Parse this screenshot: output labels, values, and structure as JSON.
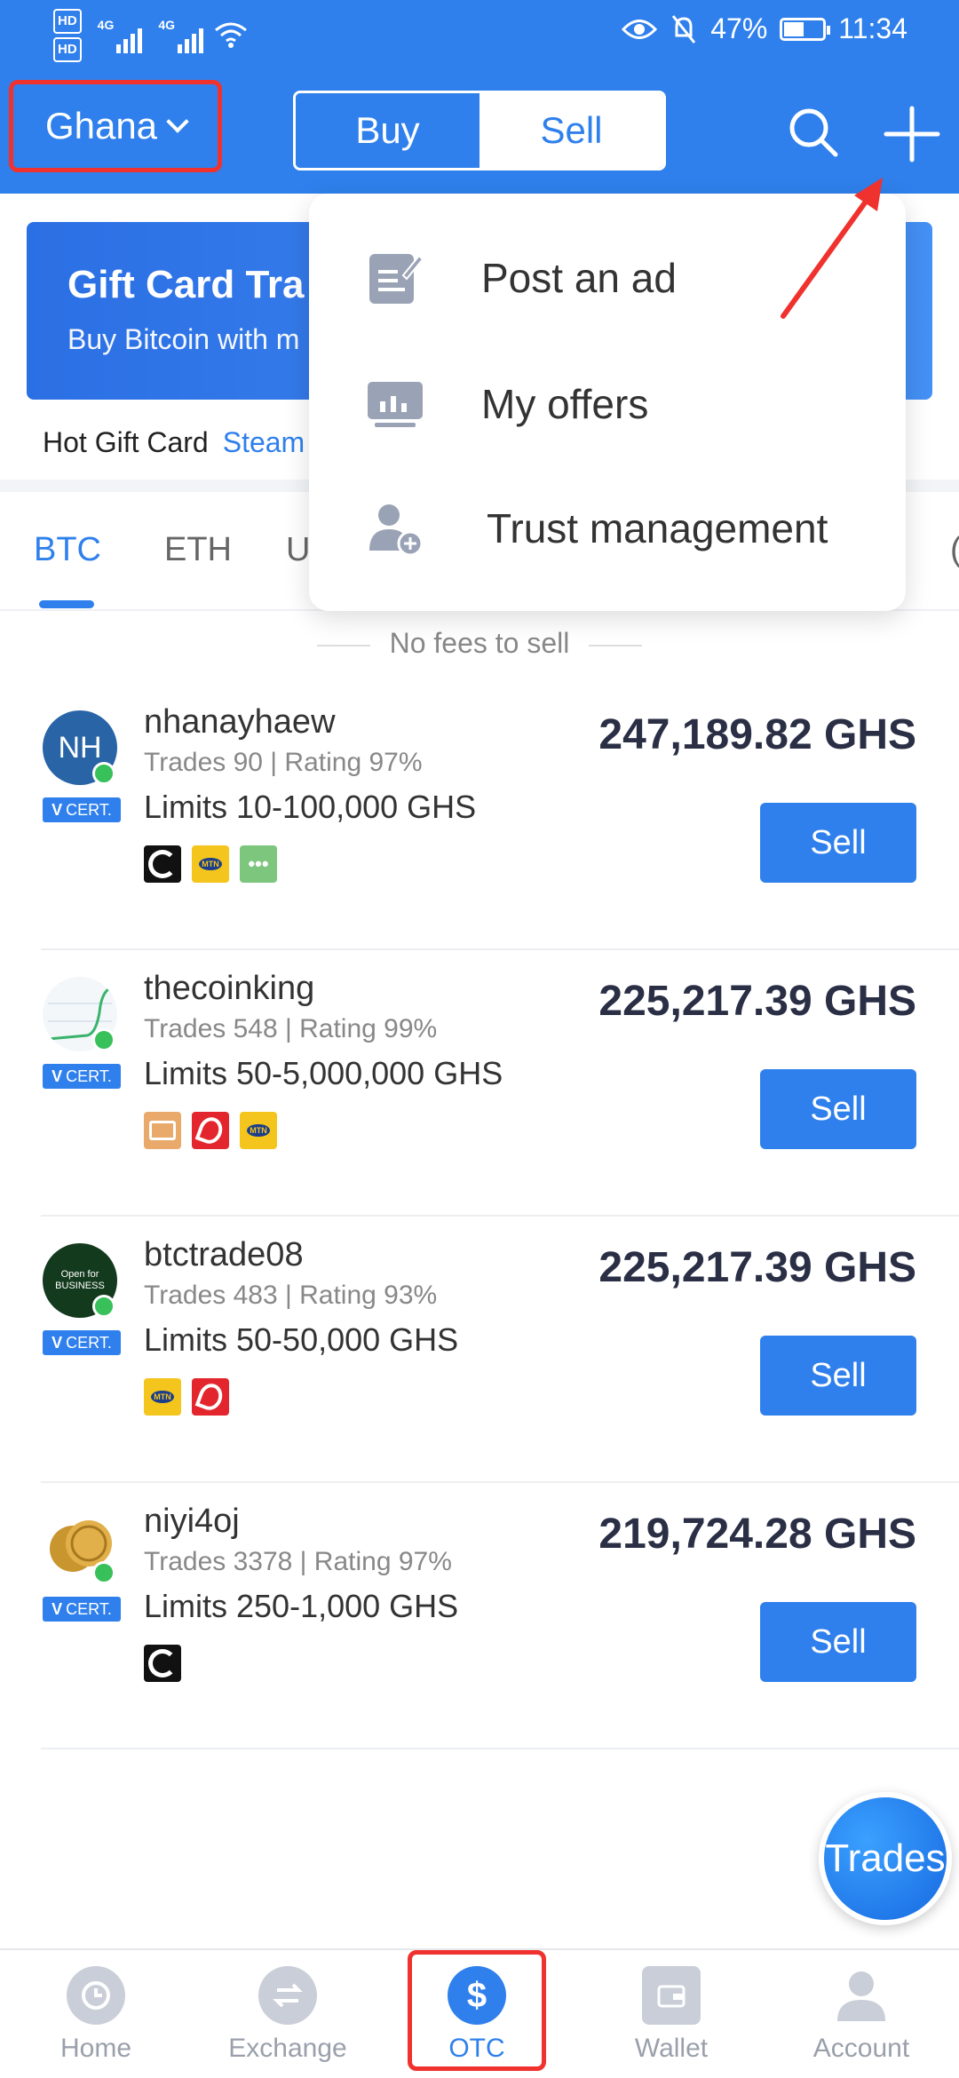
{
  "statusbar": {
    "battery": "47%",
    "time": "11:34",
    "hd1": "HD",
    "hd2": "HD",
    "net1": "4G",
    "net2": "4G"
  },
  "header": {
    "country": "Ghana",
    "segment": {
      "buy": "Buy",
      "sell": "Sell"
    }
  },
  "banner": {
    "title": "Gift Card Tra",
    "subtitle": "Buy Bitcoin with m"
  },
  "hot_gift": {
    "label": "Hot Gift Card",
    "link": "Steam"
  },
  "tabs": [
    "BTC",
    "ETH",
    "U",
    "("
  ],
  "notice": "No fees to sell",
  "offers": [
    {
      "initials": "NH",
      "name": "nhanayhaew",
      "meta": "Trades 90 | Rating 97%",
      "limits": "Limits 10-100,000 GHS",
      "price": "247,189.82 GHS",
      "action": "Sell",
      "cert": "CERT."
    },
    {
      "name": "thecoinking",
      "meta": "Trades 548 | Rating 99%",
      "limits": "Limits 50-5,000,000 GHS",
      "price": "225,217.39 GHS",
      "action": "Sell",
      "cert": "CERT."
    },
    {
      "avatar_text": "Open for BUSINESS",
      "name": "btctrade08",
      "meta": "Trades 483 | Rating 93%",
      "limits": "Limits 50-50,000 GHS",
      "price": "225,217.39 GHS",
      "action": "Sell",
      "cert": "CERT."
    },
    {
      "name": "niyi4oj",
      "meta": "Trades 3378 | Rating 97%",
      "limits": "Limits 250-1,000 GHS",
      "price": "219,724.28 GHS",
      "action": "Sell",
      "cert": "CERT."
    }
  ],
  "menu": {
    "items": [
      "Post an ad",
      "My offers",
      "Trust management"
    ]
  },
  "fab": "Trades",
  "bottom_nav": [
    {
      "label": "Home"
    },
    {
      "label": "Exchange"
    },
    {
      "label": "OTC",
      "glyph": "$"
    },
    {
      "label": "Wallet"
    },
    {
      "label": "Account"
    }
  ],
  "colors": {
    "brand": "#2f80ec",
    "highlight_box": "#f0322e",
    "online": "#38c05a"
  }
}
